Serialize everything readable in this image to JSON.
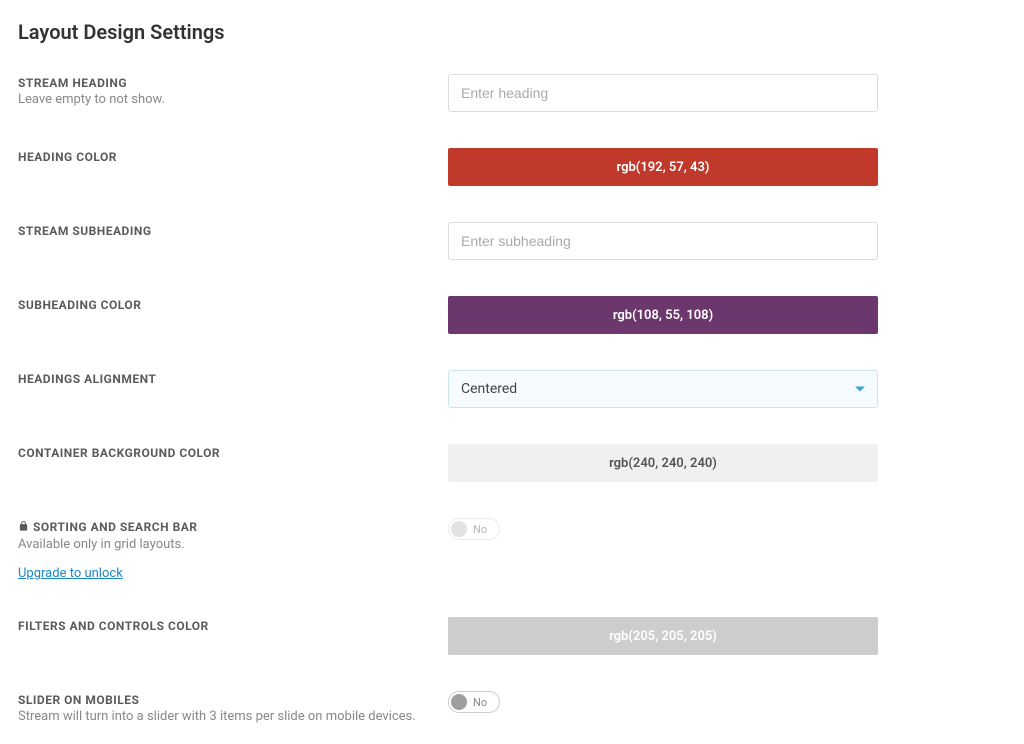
{
  "page": {
    "title": "Layout Design Settings"
  },
  "settings": {
    "stream_heading": {
      "label": "STREAM HEADING",
      "hint": "Leave empty to not show.",
      "placeholder": "Enter heading",
      "value": ""
    },
    "heading_color": {
      "label": "HEADING COLOR",
      "value": "rgb(192, 57, 43)",
      "hex": "#c0392b"
    },
    "stream_subheading": {
      "label": "STREAM SUBHEADING",
      "placeholder": "Enter subheading",
      "value": ""
    },
    "subheading_color": {
      "label": "SUBHEADING COLOR",
      "value": "rgb(108, 55, 108)",
      "hex": "#6c376c"
    },
    "headings_alignment": {
      "label": "HEADINGS ALIGNMENT",
      "selected": "Centered"
    },
    "container_bg_color": {
      "label": "CONTAINER BACKGROUND COLOR",
      "value": "rgb(240, 240, 240)",
      "hex": "#f0f0f0",
      "text_color": "#555"
    },
    "sorting_search": {
      "label": "SORTING AND SEARCH BAR",
      "hint": "Available only in grid layouts.",
      "upgrade_text": "Upgrade to unlock",
      "toggle_state": "No",
      "locked": true
    },
    "filters_color": {
      "label": "FILTERS AND CONTROLS COLOR",
      "value": "rgb(205, 205, 205)",
      "hex": "#cdcdcd",
      "text_color": "#fff"
    },
    "slider_mobiles": {
      "label": "SLIDER ON MOBILES",
      "hint": "Stream will turn into a slider with 3 items per slide on mobile devices.",
      "toggle_state": "No"
    }
  }
}
